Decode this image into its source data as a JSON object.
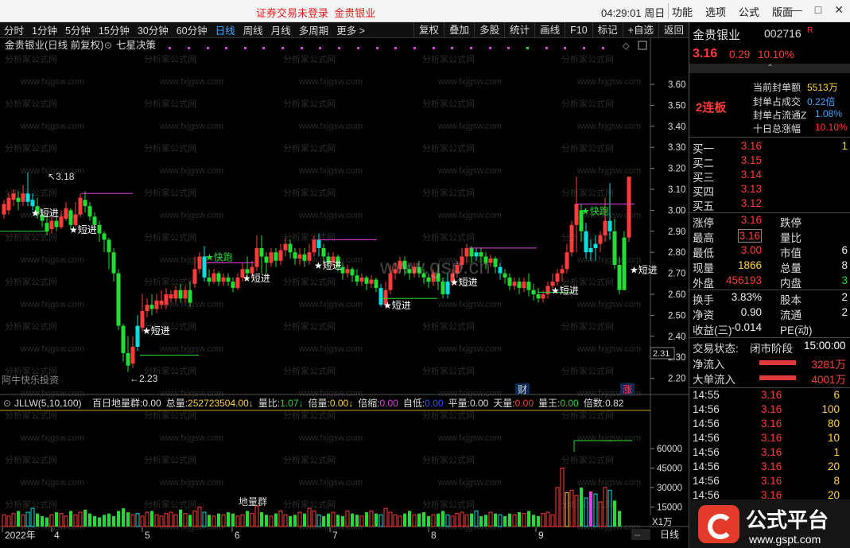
{
  "topbar": {
    "notice_login": "证券交易未登录",
    "notice_stock": "金贵银业",
    "time": "04:29:01",
    "weekday": "周日",
    "menus": [
      "功能",
      "选项",
      "公式",
      "版面"
    ],
    "win_buttons": [
      "—",
      "□",
      "✕"
    ]
  },
  "periodbar": {
    "items": [
      "分时",
      "1分钟",
      "5分钟",
      "15分钟",
      "30分钟",
      "60分钟",
      "日线",
      "周线",
      "月线",
      "多周期",
      "更多 >"
    ],
    "active": "日线",
    "right_items": [
      "复权",
      "叠加",
      "多股",
      "统计",
      "画线",
      "F10",
      "标记",
      "+自选",
      "返回"
    ]
  },
  "main_chart": {
    "header_stock": "金贵银业(日线 前复权)",
    "header_indicator": "七星决策",
    "watermark_site": "www.gsp.cn",
    "watermark_tile": "分析家公式网",
    "watermark_tile2": "www.fxjgsw.com",
    "author": "阿牛快乐投资",
    "price_axis": [
      "3.60",
      "3.50",
      "3.40",
      "3.30",
      "3.20",
      "3.10",
      "3.00",
      "2.90",
      "2.80",
      "2.70",
      "2.60",
      "2.50",
      "2.40",
      "2.30",
      "2.20"
    ],
    "current_axis_value": "2.31",
    "high_label": "3.18",
    "low_label": "2.23",
    "signal_short": "短进",
    "signal_fast": "快跑",
    "marker_cai": "财",
    "marker_zhang": "涨"
  },
  "volume_panel": {
    "header": "JLLW(5,10,100)",
    "fields": [
      {
        "label": "百日地量群:",
        "value": "0.00",
        "color": "#dddddd"
      },
      {
        "label": "总量:",
        "value": "252723504.00",
        "color": "#ffd23e",
        "arrow": "↓"
      },
      {
        "label": "量比:",
        "value": "1.07",
        "color": "#22dd33",
        "arrow": "↓"
      },
      {
        "label": "倍量:",
        "value": "0.00",
        "color": "#ffd23e",
        "arrow": "↓"
      },
      {
        "label": "倍缩:",
        "value": "0.00",
        "color": "#e040e0"
      },
      {
        "label": "自低:",
        "value": "0.00",
        "color": "#3050ff"
      },
      {
        "label": "平量:",
        "value": "0.00",
        "color": "#dddddd"
      },
      {
        "label": "天量:",
        "value": "0.00",
        "color": "#ff3b3b"
      },
      {
        "label": "量王:",
        "value": "0.00",
        "color": "#22dd33"
      },
      {
        "label": "倍数:",
        "value": "0.82",
        "color": "#dddddd"
      }
    ],
    "axis": [
      "60000",
      "45000",
      "30000",
      "15000"
    ],
    "unit": "X1万",
    "label_diliang": "地量群"
  },
  "x_axis": {
    "labels": [
      "2022年",
      "4",
      "5",
      "6",
      "7",
      "8",
      "9"
    ],
    "period": "日线"
  },
  "quote": {
    "name": "金贵银业",
    "code": "002716",
    "flag": "R",
    "price": "3.16",
    "change": "0.29",
    "pct": "10.10%",
    "boards": "2连板",
    "feng": [
      {
        "label": "当前封单额",
        "value": "5513万",
        "color": "#ffd23e"
      },
      {
        "label": "封单占成交",
        "value": "0.22倍",
        "color": "#3ea6ff"
      },
      {
        "label": "封单占流通Z",
        "value": "1.08%",
        "color": "#3ea6ff"
      },
      {
        "label": "十日总涨幅",
        "value": "10.10%",
        "color": "#ff3b3b"
      }
    ],
    "buy": [
      {
        "label": "买一",
        "price": "3.16",
        "vol": "1"
      },
      {
        "label": "买二",
        "price": "3.15",
        "vol": ""
      },
      {
        "label": "买三",
        "price": "3.14",
        "vol": ""
      },
      {
        "label": "买四",
        "price": "3.13",
        "vol": ""
      },
      {
        "label": "买五",
        "price": "3.12",
        "vol": ""
      }
    ],
    "stats": [
      {
        "l1": "涨停",
        "v1": "3.16",
        "c1": "red",
        "l2": "跌停",
        "v2": "",
        "c2": "green"
      },
      {
        "l1": "最高",
        "v1": "3.16",
        "c1": "red",
        "l2": "量比",
        "v2": "",
        "c2": "white",
        "box": true
      },
      {
        "l1": "最低",
        "v1": "3.00",
        "c1": "red",
        "l2": "市值",
        "v2": "6",
        "c2": "white"
      },
      {
        "l1": "现量",
        "v1": "1866",
        "c1": "yellow",
        "l2": "总量",
        "v2": "8",
        "c2": "white"
      },
      {
        "l1": "外盘",
        "v1": "456193",
        "c1": "red",
        "l2": "内盘",
        "v2": "3",
        "c2": "green"
      },
      {
        "l1": "换手",
        "v1": "3.83%",
        "c1": "white",
        "l2": "股本",
        "v2": "2",
        "c2": "white"
      },
      {
        "l1": "净资",
        "v1": "0.90",
        "c1": "white",
        "l2": "流通",
        "v2": "2",
        "c2": "white"
      },
      {
        "l1": "收益(三)",
        "v1": "-0.014",
        "c1": "white",
        "l2": "PE(动)",
        "v2": "",
        "c2": "white"
      }
    ],
    "trade_status_label": "交易状态:",
    "trade_status": "闭市阶段",
    "trade_time": "15:00:00",
    "net_inflow_label": "净流入",
    "net_inflow": "3281万",
    "big_inflow_label": "大单流入",
    "big_inflow": "4001万",
    "ticks": [
      {
        "t": "14:55",
        "p": "3.16",
        "v": "6"
      },
      {
        "t": "14:56",
        "p": "3.16",
        "v": "100"
      },
      {
        "t": "14:56",
        "p": "3.16",
        "v": "80"
      },
      {
        "t": "14:56",
        "p": "3.16",
        "v": "10"
      },
      {
        "t": "14:56",
        "p": "3.16",
        "v": "1"
      },
      {
        "t": "14:56",
        "p": "3.16",
        "v": "20"
      },
      {
        "t": "14:56",
        "p": "3.16",
        "v": "8"
      },
      {
        "t": "14:56",
        "p": "3.16",
        "v": "20"
      }
    ]
  },
  "brand": {
    "name": "公式平台",
    "url": "www.gspt.com"
  },
  "colors": {
    "up": "#ff3b3b",
    "down": "#22dd33",
    "cyan": "#00e0e0",
    "magenta": "#e040e0",
    "yellow": "#ffd23e"
  }
}
